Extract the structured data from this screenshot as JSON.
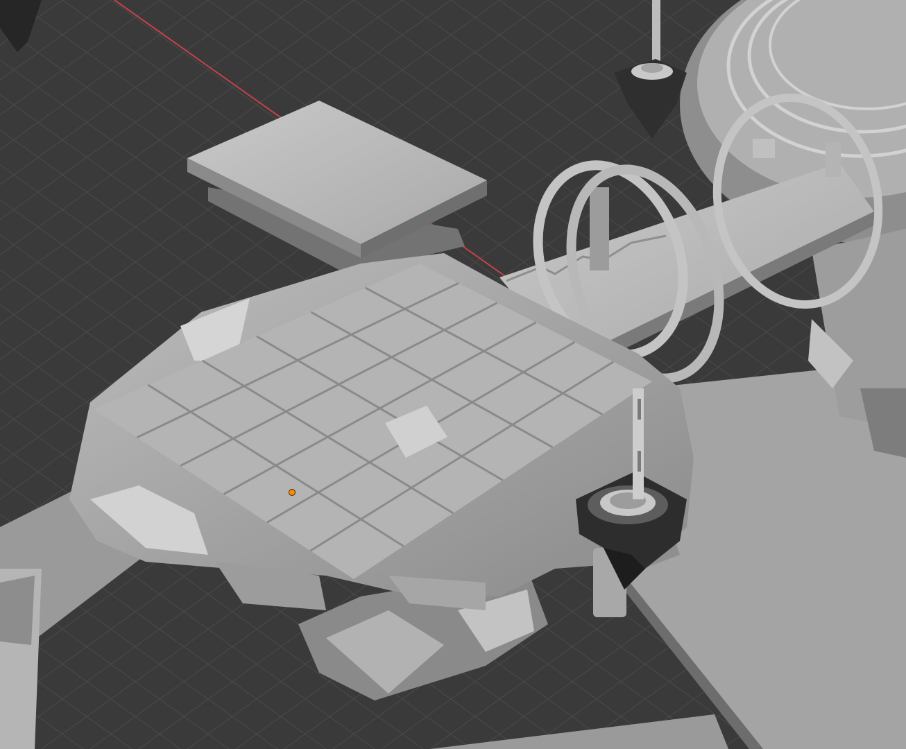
{
  "viewport": {
    "background": "#3a3a3a",
    "grid_line_color": "#4b4b4b",
    "grid_major_color": "#555555",
    "x_axis_color": "#c8404a",
    "origin_dot_color": "#ff8a00",
    "model_light": "#c6c6c6",
    "model_mid": "#a8a8a8",
    "model_dark": "#7a7a7a",
    "model_shadow": "#5a5a5a",
    "metal_dark": "#2a2a2a"
  },
  "objects": {
    "platform": "main-tiled-platform",
    "bridge": "walkway-bridge",
    "rings": "arch-rings",
    "pylon_near": "floating-pylon-near",
    "pylon_far": "floating-pylon-far",
    "slab": "floating-slab",
    "round_base": "round-stepped-base",
    "ramp_right": "side-ramp",
    "selection_origin": "object-origin"
  }
}
